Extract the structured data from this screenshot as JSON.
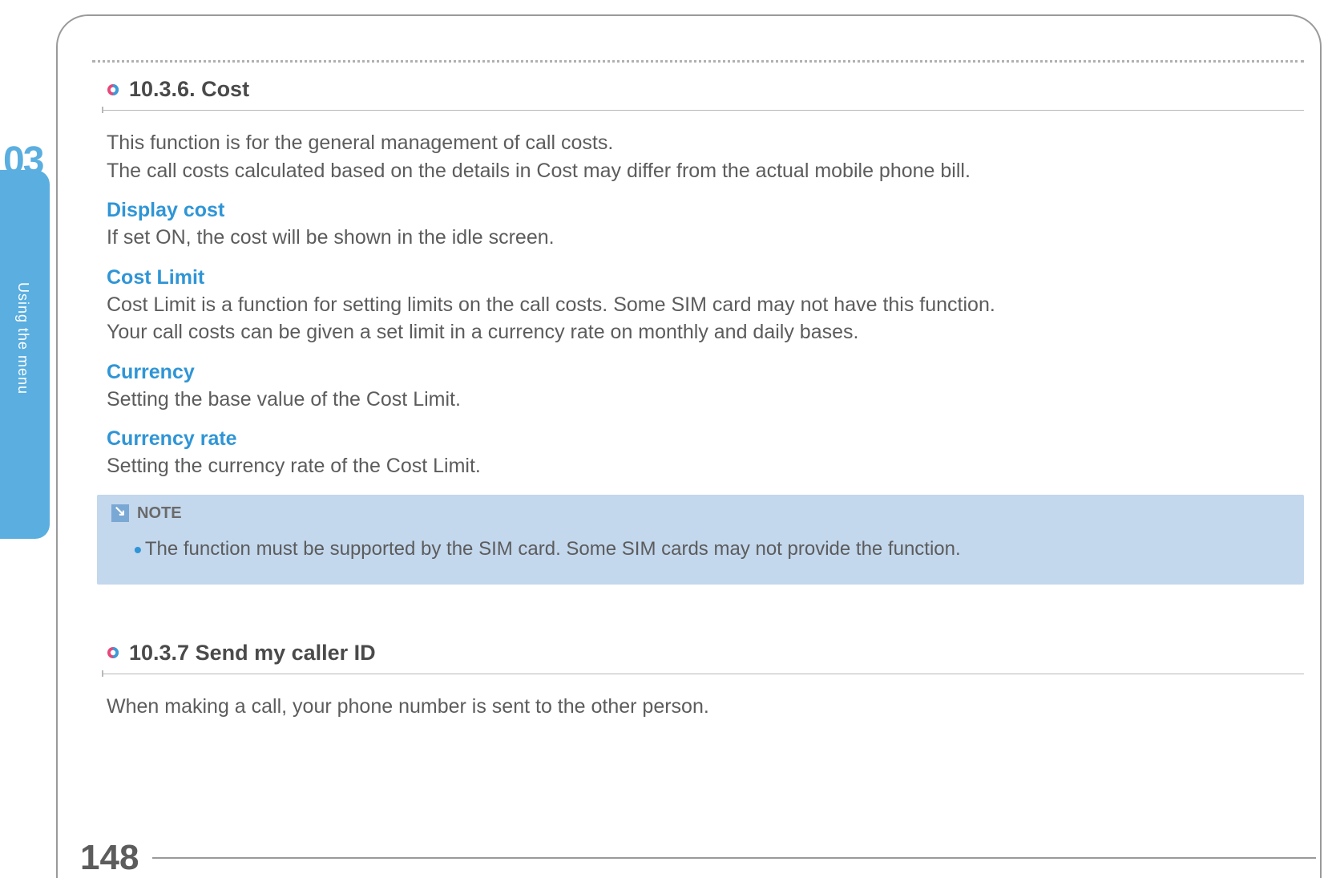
{
  "chapter": {
    "number": "03",
    "label": "Using the menu"
  },
  "page_number": "148",
  "sections": [
    {
      "heading": "10.3.6. Cost",
      "intro": "This function is for the general management of call costs.\nThe call costs calculated based on the details in Cost may differ from the actual mobile phone bill.",
      "subs": [
        {
          "title": "Display cost",
          "body": "If set ON, the cost will be shown in the idle screen."
        },
        {
          "title": "Cost Limit",
          "body": "Cost Limit is a function for setting limits on the call costs. Some SIM card may not have this function.\nYour call costs can be given a set limit in a currency rate on monthly and daily bases."
        },
        {
          "title": "Currency",
          "body": "Setting the base value of the Cost Limit."
        },
        {
          "title": "Currency rate",
          "body": "Setting the currency rate of the Cost Limit."
        }
      ],
      "note": {
        "label": "NOTE",
        "items": [
          "The function must be supported by the SIM card. Some SIM cards may not provide the function."
        ]
      }
    },
    {
      "heading": "10.3.7 Send my caller ID",
      "intro": "When making a call, your phone number is sent to the other person."
    }
  ]
}
